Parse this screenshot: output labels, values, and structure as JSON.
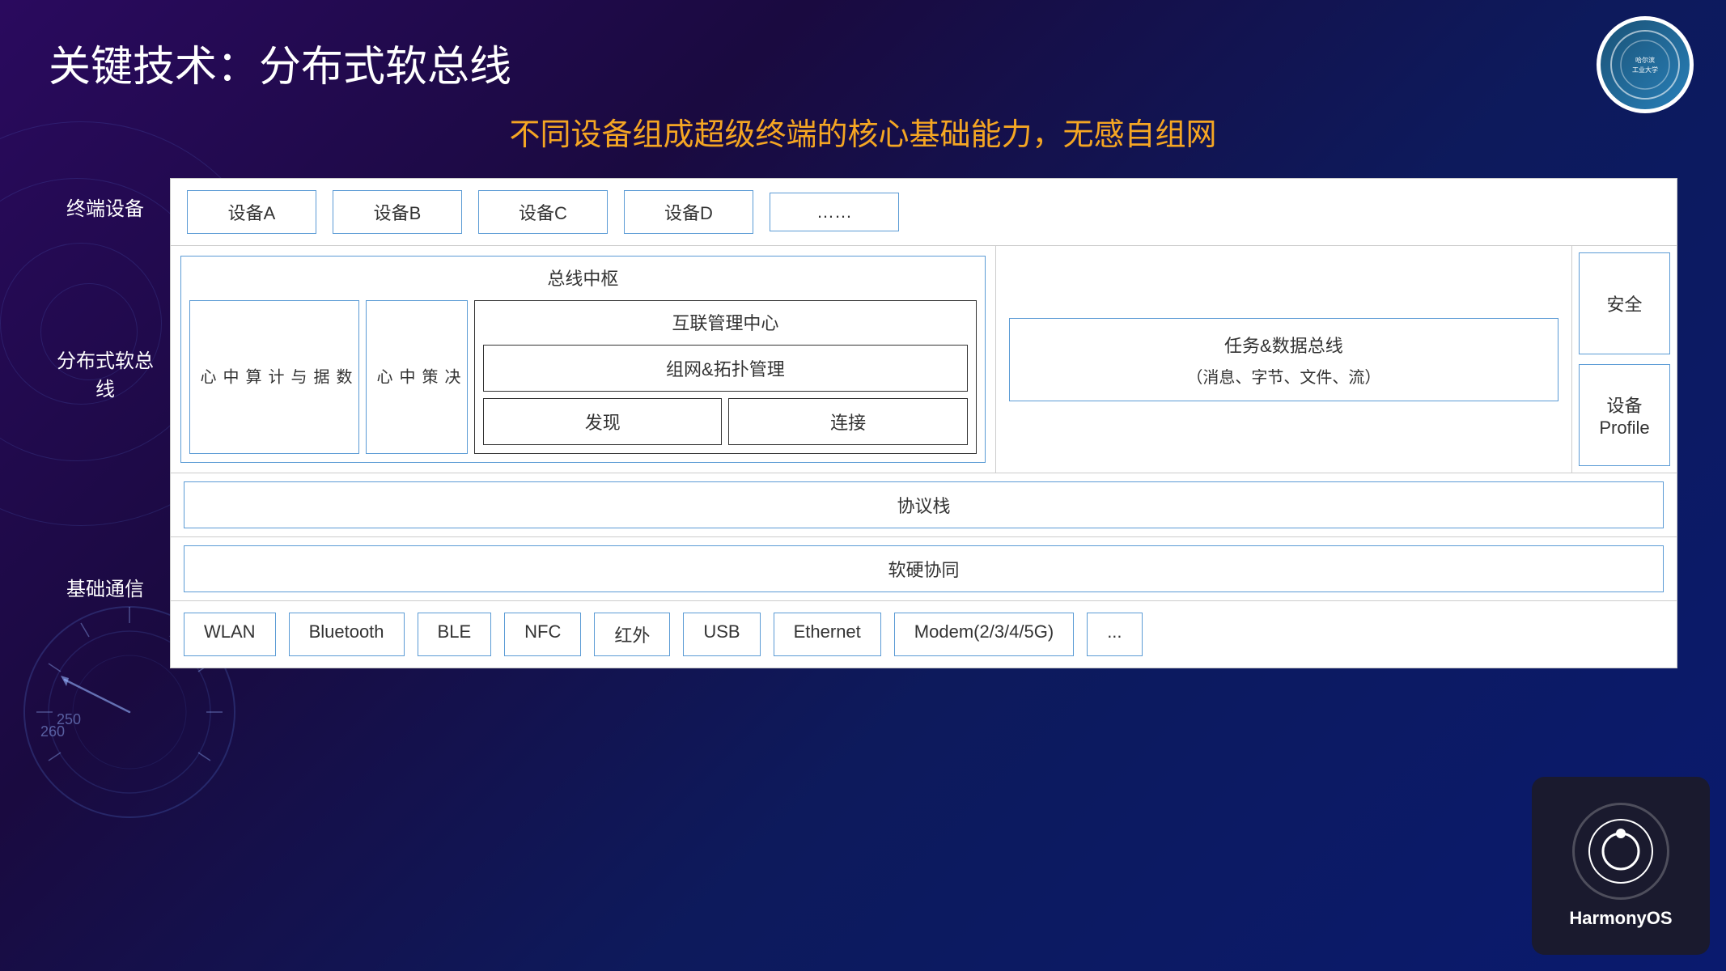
{
  "page": {
    "title": "关键技术：分布式软总线",
    "subtitle": "不同设备组成超级终端的核心基础能力，无感自组网"
  },
  "devices": {
    "label": "终端设备",
    "items": [
      "设备A",
      "设备B",
      "设备C",
      "设备D",
      "……"
    ]
  },
  "distributed_bus": {
    "outer_label": "分布式软总线",
    "bus_hub": {
      "title": "总线中枢",
      "data_center": "数据与计算中心",
      "decision_center": "决策中心",
      "interconnect": {
        "title": "互联管理中心",
        "topology": "组网&拓扑管理",
        "discover": "发现",
        "connect": "连接"
      }
    },
    "task_bus": {
      "line1": "任务&数据总线",
      "line2": "（消息、字节、文件、流）"
    },
    "safety": "安全",
    "device_profile": "设备\nProfile"
  },
  "protocol_stack": {
    "label": "",
    "title": "协议栈"
  },
  "basic_comm": {
    "label": "基础通信",
    "hw_coord": "软硬协同",
    "protocols": [
      "WLAN",
      "Bluetooth",
      "BLE",
      "NFC",
      "红外",
      "USB",
      "Ethernet",
      "Modem(2/3/4/5G)",
      "..."
    ]
  },
  "harmony_logo": {
    "text": "HarmonyOS"
  },
  "gauge": {
    "numbers": [
      "260",
      "250"
    ]
  }
}
